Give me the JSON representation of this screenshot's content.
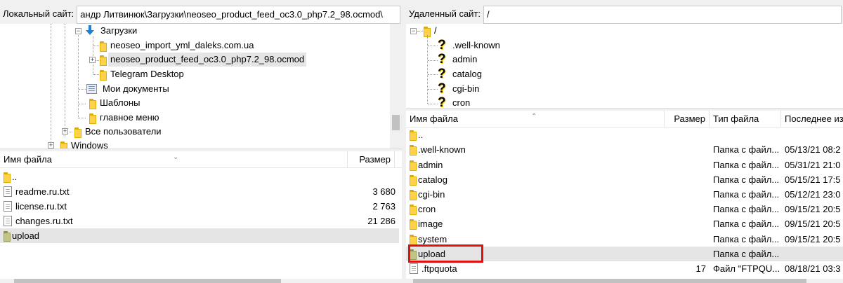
{
  "local": {
    "site_label": "Локальный сайт:",
    "path": "андр Литвинюк\\Загрузки\\neoseo_product_feed_oc3.0_php7.2_98.ocmod\\",
    "tree": [
      {
        "label": "Загрузки",
        "icon": "download-arrow-icon"
      },
      {
        "label": "neoseo_import_yml_daleks.com.ua",
        "icon": "folder-icon"
      },
      {
        "label": "neoseo_product_feed_oc3.0_php7.2_98.ocmod",
        "icon": "folder-icon"
      },
      {
        "label": "Telegram Desktop",
        "icon": "folder-icon"
      },
      {
        "label": "Мои документы",
        "icon": "documents-icon"
      },
      {
        "label": "Шаблоны",
        "icon": "folder-icon"
      },
      {
        "label": "главное меню",
        "icon": "folder-icon"
      },
      {
        "label": "Все пользователи",
        "icon": "folder-icon"
      },
      {
        "label": "Windows",
        "icon": "folder-icon"
      }
    ],
    "columns": {
      "name": "Имя файла",
      "size": "Размер"
    },
    "files": [
      {
        "name": "..",
        "size": "",
        "icon": "folder-icon"
      },
      {
        "name": "readme.ru.txt",
        "size": "3 680",
        "icon": "text-file-icon"
      },
      {
        "name": "license.ru.txt",
        "size": "2 763",
        "icon": "text-file-icon"
      },
      {
        "name": "changes.ru.txt",
        "size": "21 286",
        "icon": "text-file-icon"
      },
      {
        "name": "upload",
        "size": "",
        "icon": "folder-icon"
      }
    ]
  },
  "remote": {
    "site_label": "Удаленный сайт:",
    "path": "/",
    "tree": [
      {
        "label": "/",
        "icon": "folder-icon"
      },
      {
        "label": ".well-known",
        "icon": "unknown-folder-icon"
      },
      {
        "label": "admin",
        "icon": "unknown-folder-icon"
      },
      {
        "label": "catalog",
        "icon": "unknown-folder-icon"
      },
      {
        "label": "cgi-bin",
        "icon": "unknown-folder-icon"
      },
      {
        "label": "cron",
        "icon": "unknown-folder-icon"
      }
    ],
    "columns": {
      "name": "Имя файла",
      "size": "Размер",
      "type": "Тип файла",
      "modified": "Последнее изм"
    },
    "files": [
      {
        "name": "..",
        "size": "",
        "type": "",
        "modified": "",
        "icon": "folder-icon"
      },
      {
        "name": ".well-known",
        "size": "",
        "type": "Папка с файл...",
        "modified": "05/13/21 08:2",
        "icon": "folder-icon"
      },
      {
        "name": "admin",
        "size": "",
        "type": "Папка с файл...",
        "modified": "05/31/21 21:0",
        "icon": "folder-icon"
      },
      {
        "name": "catalog",
        "size": "",
        "type": "Папка с файл...",
        "modified": "05/15/21 17:5",
        "icon": "folder-icon"
      },
      {
        "name": "cgi-bin",
        "size": "",
        "type": "Папка с файл...",
        "modified": "05/12/21 23:0",
        "icon": "folder-icon"
      },
      {
        "name": "cron",
        "size": "",
        "type": "Папка с файл...",
        "modified": "09/15/21 20:5",
        "icon": "folder-icon"
      },
      {
        "name": "image",
        "size": "",
        "type": "Папка с файл...",
        "modified": "09/15/21 20:5",
        "icon": "folder-icon"
      },
      {
        "name": "system",
        "size": "",
        "type": "Папка с файл...",
        "modified": "09/15/21 20:5",
        "icon": "folder-icon"
      },
      {
        "name": "upload",
        "size": "",
        "type": "Папка с файл...",
        "modified": "",
        "icon": "folder-icon"
      },
      {
        "name": ".ftpquota",
        "size": "17",
        "type": "Файл \"FTPQU...",
        "modified": "08/18/21 03:3",
        "icon": "file-icon"
      }
    ]
  },
  "highlight_color": "#e01010"
}
